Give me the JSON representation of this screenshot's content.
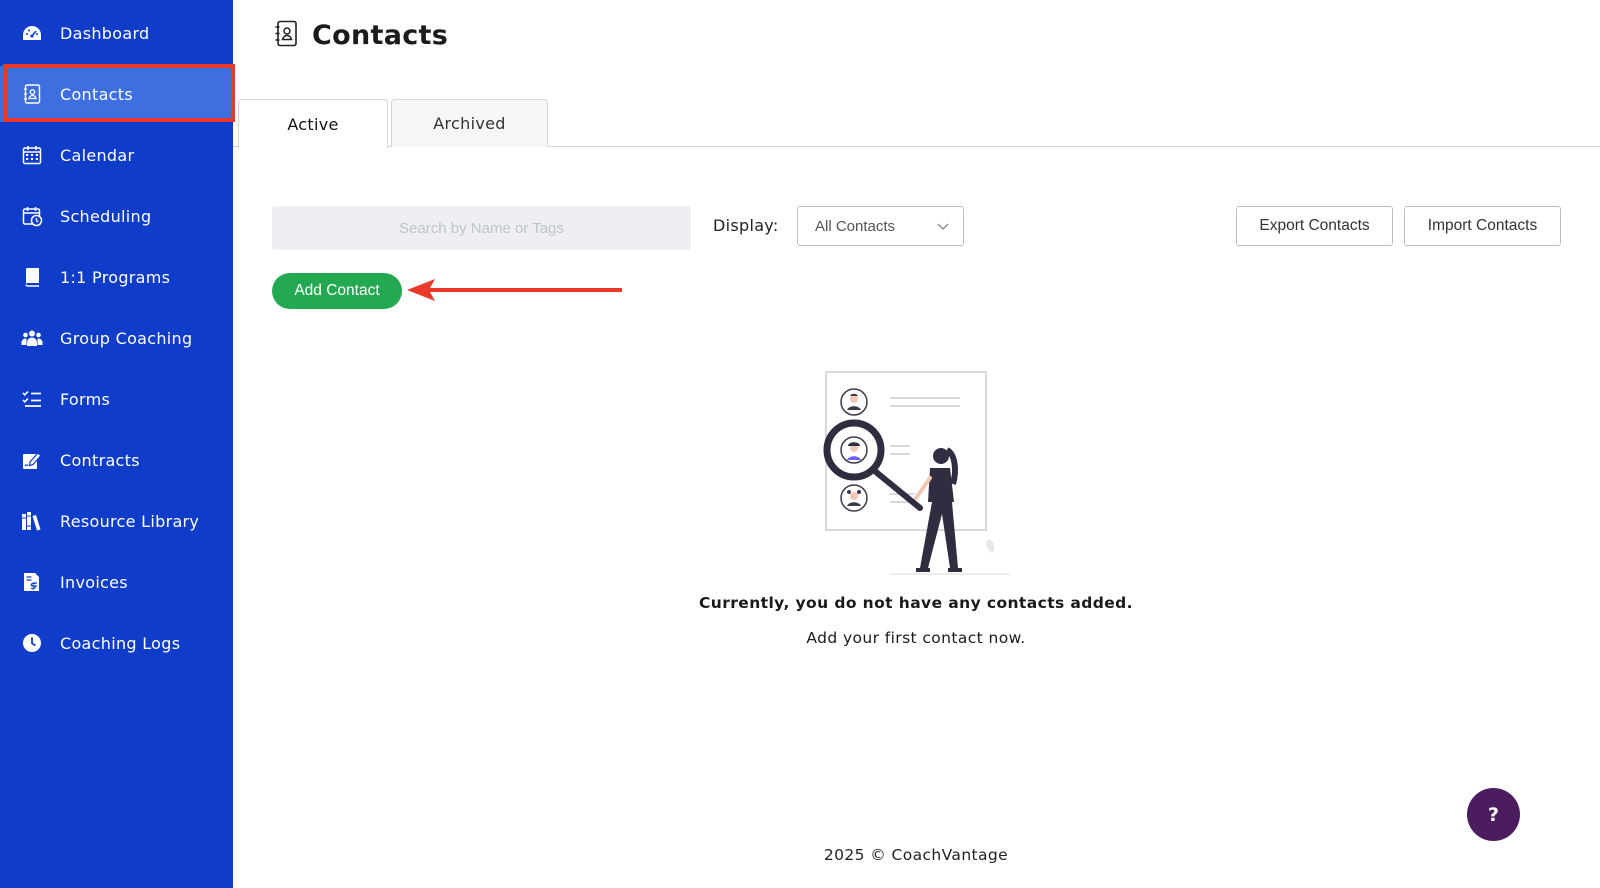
{
  "sidebar": {
    "items": [
      {
        "label": "Dashboard",
        "icon": "gauge-icon"
      },
      {
        "label": "Contacts",
        "icon": "contact-book-icon",
        "active": true
      },
      {
        "label": "Calendar",
        "icon": "calendar-icon"
      },
      {
        "label": "Scheduling",
        "icon": "calendar-clock-icon"
      },
      {
        "label": "1:1 Programs",
        "icon": "book-icon"
      },
      {
        "label": "Group Coaching",
        "icon": "group-icon"
      },
      {
        "label": "Forms",
        "icon": "checklist-icon"
      },
      {
        "label": "Contracts",
        "icon": "signature-icon"
      },
      {
        "label": "Resource Library",
        "icon": "library-icon"
      },
      {
        "label": "Invoices",
        "icon": "invoice-icon"
      },
      {
        "label": "Coaching Logs",
        "icon": "clock-icon"
      }
    ]
  },
  "page": {
    "title": "Contacts",
    "title_icon": "contact-book-icon"
  },
  "tabs": [
    {
      "label": "Active",
      "active": true
    },
    {
      "label": "Archived",
      "active": false
    }
  ],
  "toolbar": {
    "search_placeholder": "Search by Name or Tags",
    "display_label": "Display:",
    "display_value": "All Contacts",
    "export_label": "Export Contacts",
    "import_label": "Import Contacts",
    "add_label": "Add Contact"
  },
  "empty_state": {
    "title": "Currently, you do not have any contacts added.",
    "subtitle": "Add your first contact now."
  },
  "footer": {
    "text": "2025 © CoachVantage"
  },
  "help": {
    "label": "?"
  },
  "colors": {
    "sidebar": "#0f3dc9",
    "sidebar_active": "#3e6fe0",
    "highlight": "#e8392a",
    "add_button": "#22a952",
    "help_button": "#4c1d5e"
  }
}
